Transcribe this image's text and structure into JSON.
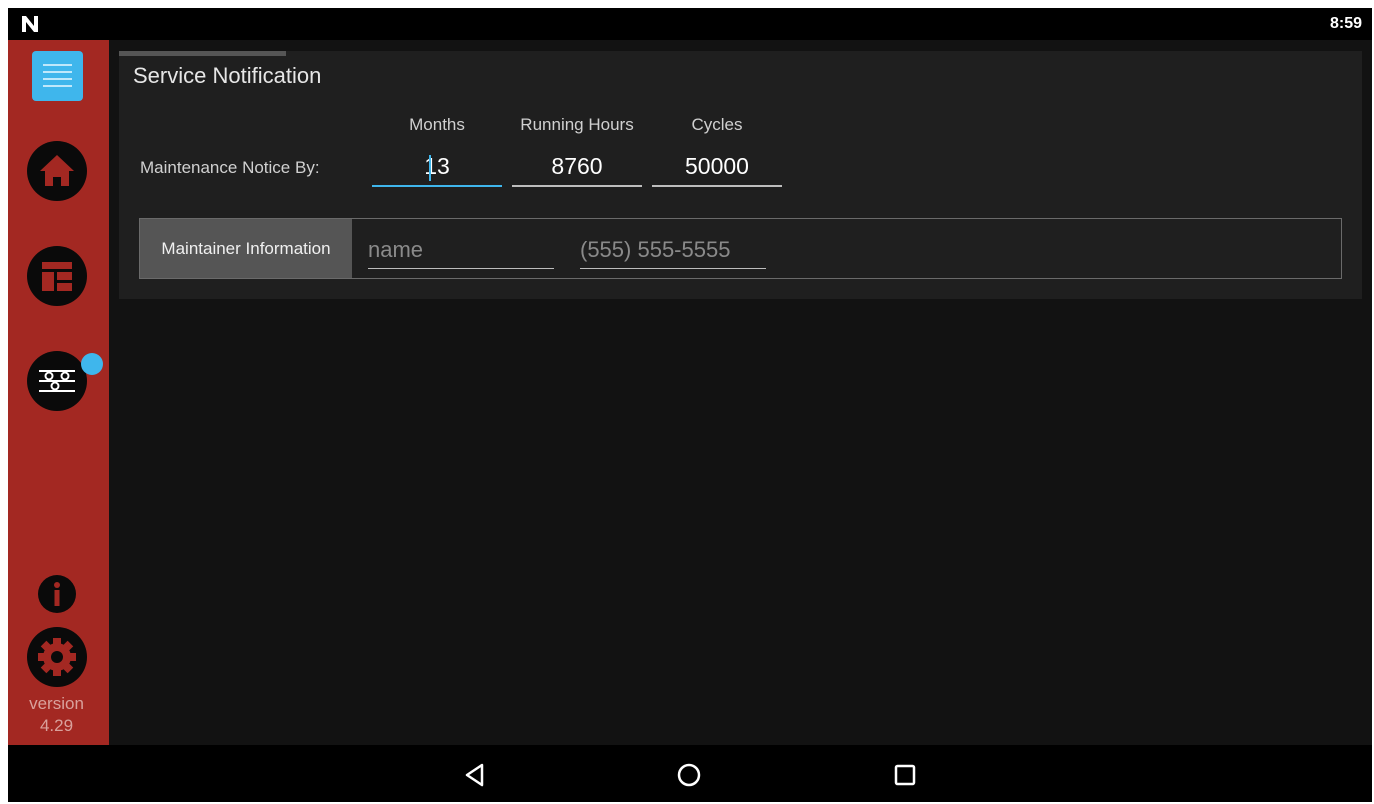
{
  "status_bar": {
    "time": "8:59",
    "logo_icon": "n-logo-icon"
  },
  "sidebar": {
    "items": [
      {
        "name": "menu",
        "icon": "menu-icon"
      },
      {
        "name": "home",
        "icon": "home-icon"
      },
      {
        "name": "layout",
        "icon": "layout-icon"
      },
      {
        "name": "adjustments",
        "icon": "sliders-icon"
      },
      {
        "name": "info",
        "icon": "info-icon"
      },
      {
        "name": "settings",
        "icon": "gear-icon"
      }
    ],
    "version_label": "version",
    "version_number": "4.29"
  },
  "panel": {
    "title": "Service Notification",
    "notice_label": "Maintenance Notice By:",
    "columns": {
      "months": {
        "header": "Months",
        "value": "13"
      },
      "running_hours": {
        "header": "Running Hours",
        "value": "8760"
      },
      "cycles": {
        "header": "Cycles",
        "value": "50000"
      }
    },
    "maintainer": {
      "label": "Maintainer Information",
      "name_placeholder": "name",
      "phone_placeholder": "(555) 555-5555"
    }
  },
  "nav_bar": {
    "back_icon": "back-triangle-icon",
    "home_icon": "home-circle-icon",
    "recents_icon": "recents-square-icon"
  },
  "colors": {
    "sidebar": "#a32822",
    "accent": "#3fb6ec",
    "panel": "#1f1f1f",
    "background": "#121212"
  }
}
